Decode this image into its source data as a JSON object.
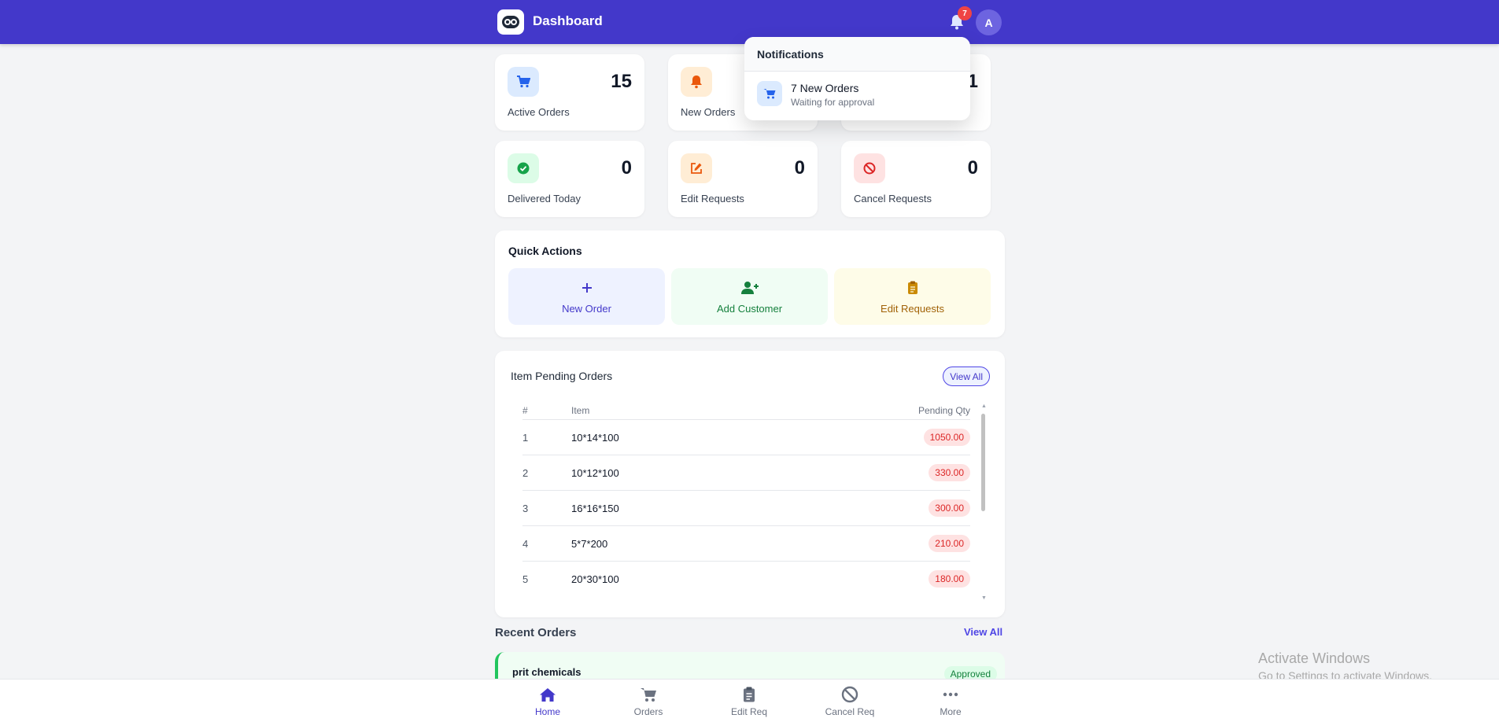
{
  "header": {
    "title": "Dashboard",
    "notification_count": "7",
    "avatar_initial": "A",
    "bg_color": "#4338ca"
  },
  "stats": [
    {
      "label": "Active Orders",
      "value": "15",
      "icon": "cart-icon",
      "icon_bg": "#dbeafe",
      "icon_color": "#2563eb"
    },
    {
      "label": "New Orders",
      "value": "",
      "icon": "bell-icon",
      "icon_bg": "#ffedd5",
      "icon_color": "#ea580c"
    },
    {
      "label": "",
      "value": "1",
      "icon": "",
      "icon_bg": "",
      "icon_color": ""
    },
    {
      "label": "Delivered Today",
      "value": "0",
      "icon": "check-circle-icon",
      "icon_bg": "#dcfce7",
      "icon_color": "#16a34a"
    },
    {
      "label": "Edit Requests",
      "value": "0",
      "icon": "edit-icon",
      "icon_bg": "#ffedd5",
      "icon_color": "#ea580c"
    },
    {
      "label": "Cancel Requests",
      "value": "0",
      "icon": "ban-icon",
      "icon_bg": "#fee2e2",
      "icon_color": "#dc2626"
    }
  ],
  "quick_actions": {
    "title": "Quick Actions",
    "items": [
      {
        "label": "New Order",
        "icon": "plus-icon",
        "bg": "#eef2ff",
        "color": "#4338ca"
      },
      {
        "label": "Add Customer",
        "icon": "user-plus-icon",
        "bg": "#f0fdf4",
        "color": "#15803d"
      },
      {
        "label": "Edit Requests",
        "icon": "clipboard-icon",
        "bg": "#fefce8",
        "color": "#a16207"
      }
    ]
  },
  "pending": {
    "title": "Item Pending Orders",
    "view_all": "View All",
    "columns": [
      "#",
      "Item",
      "Pending Qty"
    ],
    "rows": [
      {
        "num": "1",
        "item": "10*14*100",
        "qty": "1050.00"
      },
      {
        "num": "2",
        "item": "10*12*100",
        "qty": "330.00"
      },
      {
        "num": "3",
        "item": "16*16*150",
        "qty": "300.00"
      },
      {
        "num": "4",
        "item": "5*7*200",
        "qty": "210.00"
      },
      {
        "num": "5",
        "item": "20*30*100",
        "qty": "180.00"
      }
    ]
  },
  "recent": {
    "title": "Recent Orders",
    "view_all": "View All",
    "orders": [
      {
        "name": "prit chemicals",
        "status": "Approved"
      }
    ]
  },
  "notifications": {
    "title": "Notifications",
    "items": [
      {
        "title": "7 New Orders",
        "subtitle": "Waiting for approval",
        "icon": "cart-icon"
      }
    ]
  },
  "bottom_nav": [
    {
      "label": "Home",
      "icon": "home-icon",
      "active": true
    },
    {
      "label": "Orders",
      "icon": "cart-icon",
      "active": false
    },
    {
      "label": "Edit Req",
      "icon": "clipboard-icon",
      "active": false
    },
    {
      "label": "Cancel Req",
      "icon": "ban-icon",
      "active": false
    },
    {
      "label": "More",
      "icon": "more-icon",
      "active": false
    }
  ],
  "watermark": {
    "line1": "Activate Windows",
    "line2": "Go to Settings to activate Windows."
  }
}
